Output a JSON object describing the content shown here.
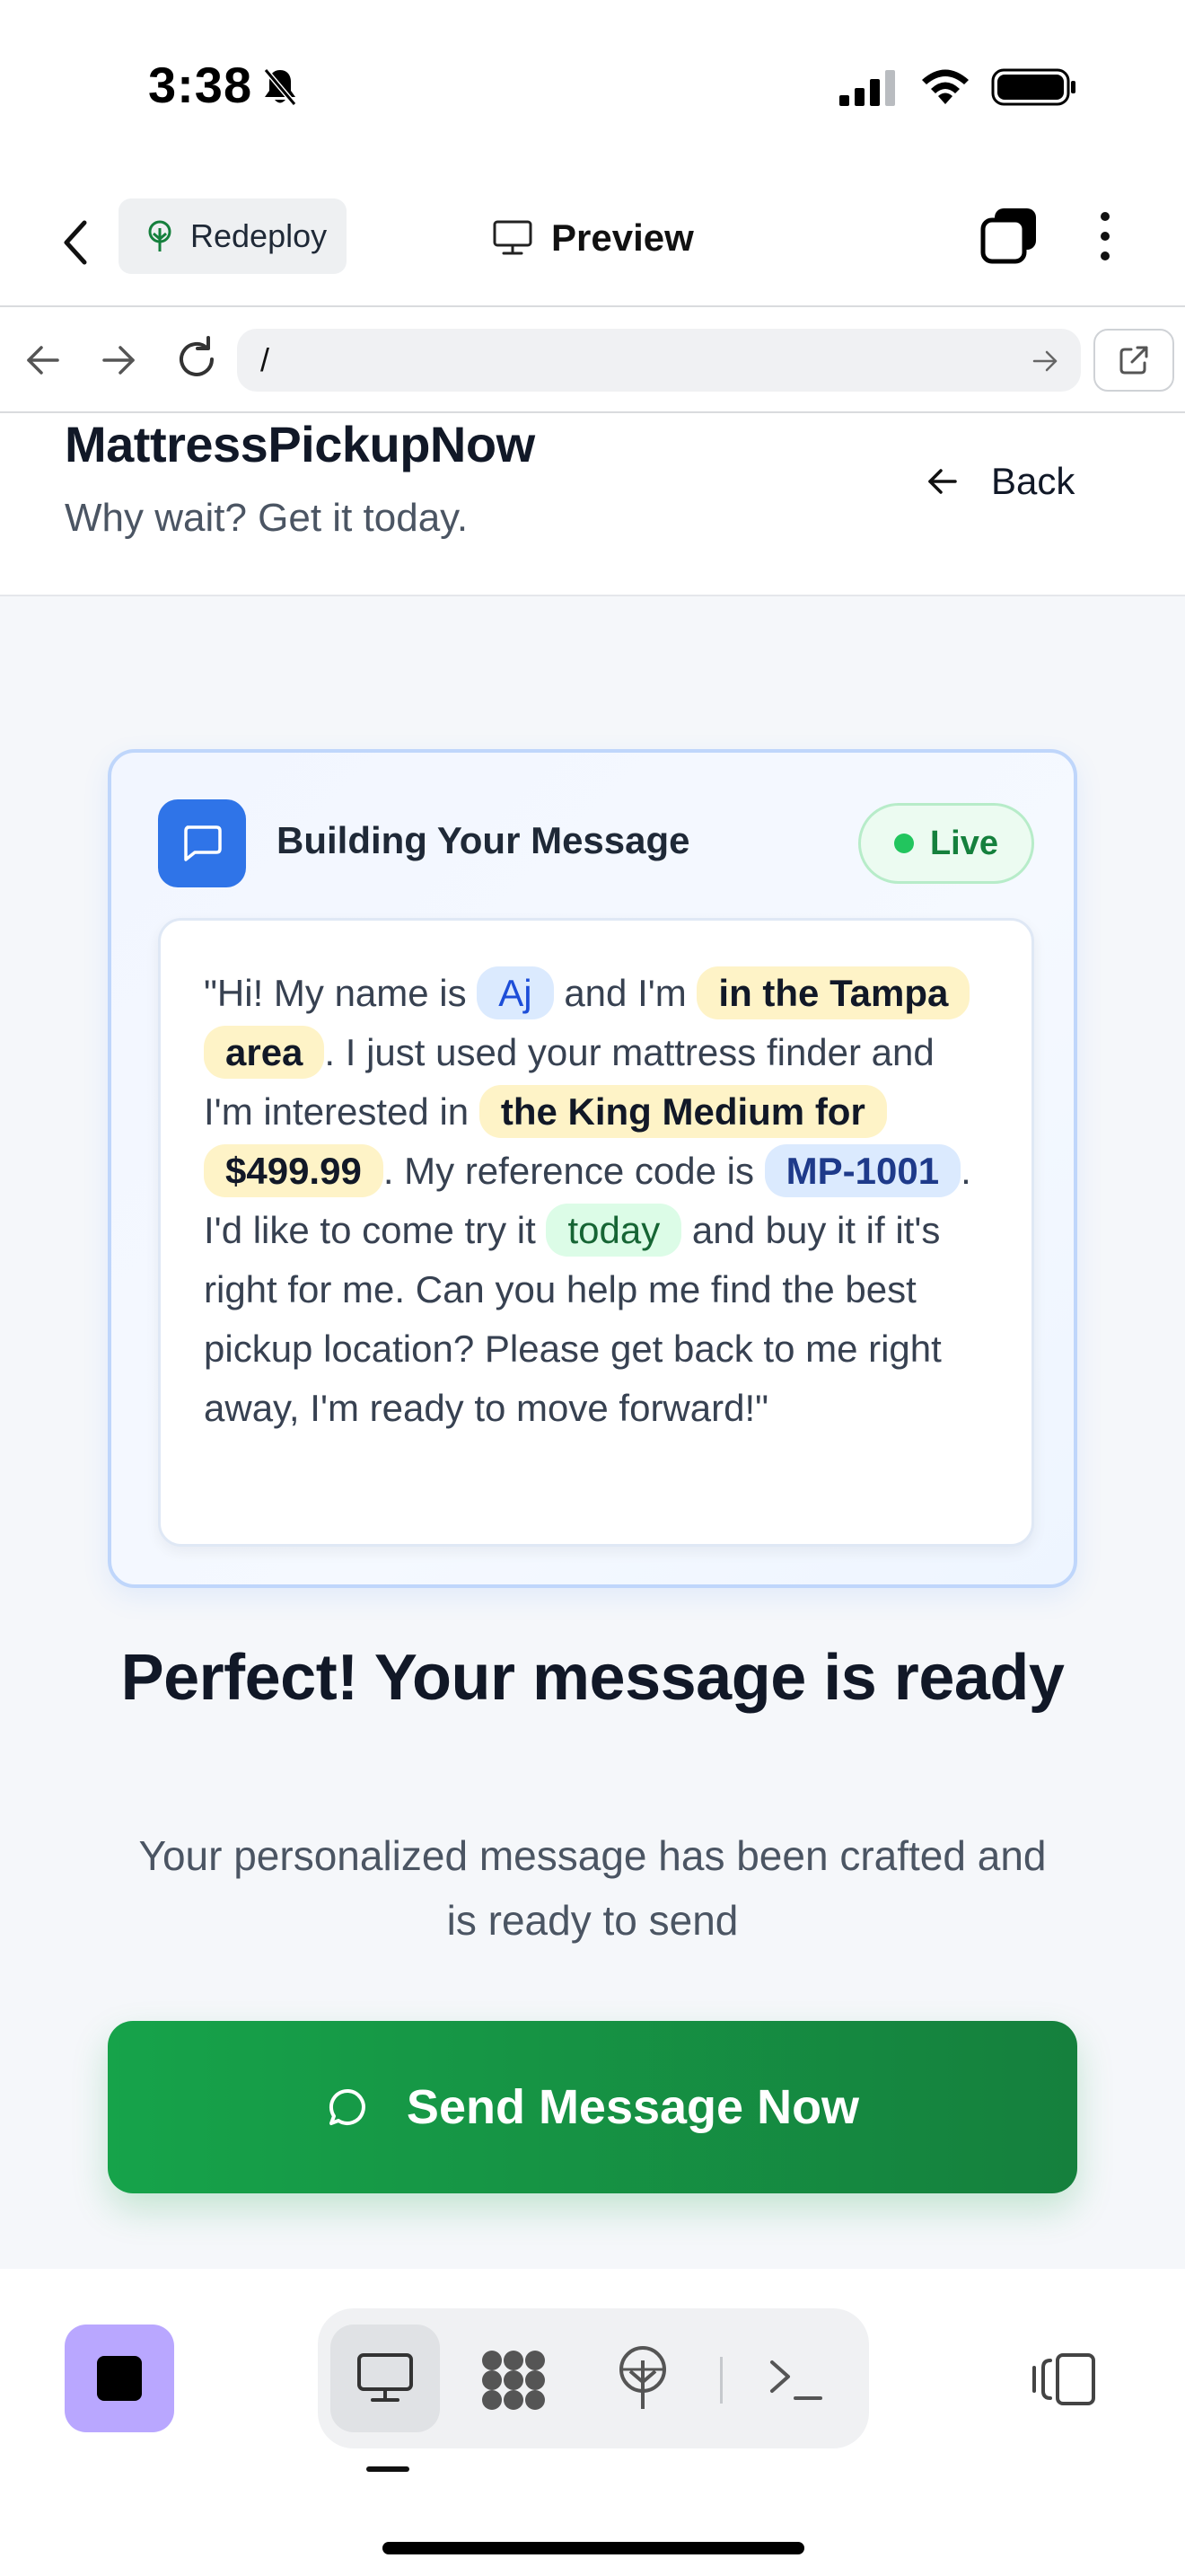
{
  "status_bar": {
    "time": "3:38",
    "icons": [
      "bell-slash-icon",
      "signal-icon",
      "wifi-icon",
      "battery-icon"
    ]
  },
  "app_header": {
    "back_icon": "chevron-left-icon",
    "redeploy_label": "Redeploy",
    "preview_label": "Preview",
    "tabs_icon": "tabs-icon",
    "more_icon": "more-vertical-icon"
  },
  "browser": {
    "url": "/",
    "icons": [
      "arrow-left-icon",
      "arrow-right-icon",
      "reload-icon",
      "go-arrow-icon",
      "external-link-icon"
    ]
  },
  "site": {
    "title": "MattressPickupNow",
    "tagline": "Why wait? Get it today.",
    "back_label": "Back"
  },
  "message_card": {
    "title": "Building Your Message",
    "live_label": "Live",
    "parts": {
      "p1": "\"Hi! My name is ",
      "name": "Aj",
      "p2": " and I'm ",
      "area": "in the Tampa area",
      "p3": ". I just used your mattress finder and I'm interested in ",
      "product": "the King Medium for $499.99",
      "p4": ". My reference code is ",
      "ref": "MP-1001",
      "p5": ". I'd like to come try it ",
      "when": "today",
      "p6": " and buy it if it's right for me. Can you help me find the best pickup location? Please get back to me right away, I'm ready to move forward!\""
    }
  },
  "ready": {
    "title": "Perfect! Your message is ready",
    "subtitle": "Your personalized message has been crafted and is ready to send"
  },
  "send_button_label": "Send Message Now",
  "colors": {
    "accent_blue": "#2f74e8",
    "send_green": "#16a34a",
    "live_green": "#22c55e",
    "stop_purple": "#b9a7ff"
  }
}
